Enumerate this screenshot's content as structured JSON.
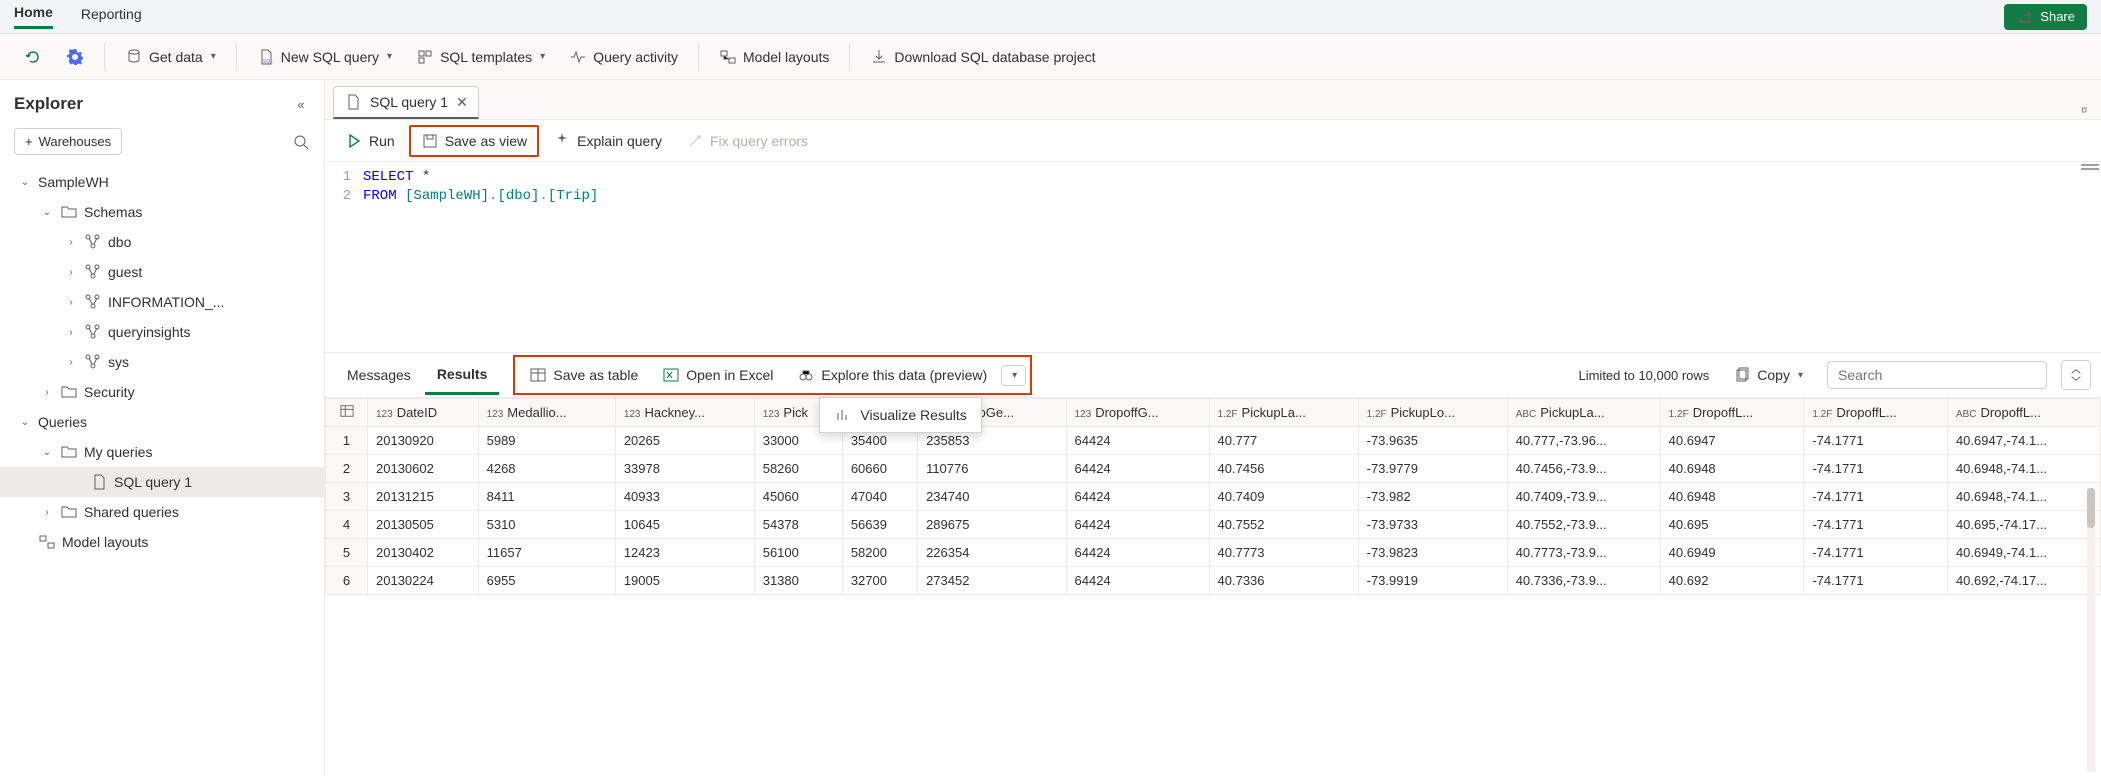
{
  "top": {
    "home": "Home",
    "reporting": "Reporting",
    "share": "Share"
  },
  "toolbar": {
    "get_data": "Get data",
    "new_sql": "New SQL query",
    "sql_templates": "SQL templates",
    "query_activity": "Query activity",
    "model_layouts": "Model layouts",
    "download": "Download SQL database project"
  },
  "explorer": {
    "title": "Explorer",
    "warehouses": "Warehouses",
    "tree": {
      "samplewh": "SampleWH",
      "schemas": "Schemas",
      "dbo": "dbo",
      "guest": "guest",
      "info": "INFORMATION_...",
      "qi": "queryinsights",
      "sys": "sys",
      "security": "Security",
      "queries": "Queries",
      "myq": "My queries",
      "sq1": "SQL query 1",
      "shared": "Shared queries",
      "model": "Model layouts"
    }
  },
  "query_tab": {
    "label": "SQL query 1"
  },
  "qtoolbar": {
    "run": "Run",
    "save_view": "Save as view",
    "explain": "Explain query",
    "fix": "Fix query errors"
  },
  "sql": {
    "l1a": "SELECT",
    "l1b": " *",
    "l2a": "FROM",
    "l2b": " [SampleWH]",
    "l2c": ".",
    "l2d": "[dbo]",
    "l2e": ".",
    "l2f": "[Trip]"
  },
  "results": {
    "messages": "Messages",
    "results": "Results",
    "save_table": "Save as table",
    "open_excel": "Open in Excel",
    "explore": "Explore this data (preview)",
    "visualize": "Visualize Results",
    "limit": "Limited to 10,000 rows",
    "copy": "Copy",
    "search_ph": "Search"
  },
  "columns": [
    {
      "t": "123",
      "n": "DateID"
    },
    {
      "t": "123",
      "n": "Medallio..."
    },
    {
      "t": "123",
      "n": "Hackney..."
    },
    {
      "t": "123",
      "n": "Pick"
    },
    {
      "t": "123",
      "n": ""
    },
    {
      "t": "123",
      "n": "PickupGe..."
    },
    {
      "t": "123",
      "n": "DropoffG..."
    },
    {
      "t": "1.2F",
      "n": "PickupLa..."
    },
    {
      "t": "1.2F",
      "n": "PickupLo..."
    },
    {
      "t": "ABC",
      "n": "PickupLa..."
    },
    {
      "t": "1.2F",
      "n": "DropoffL..."
    },
    {
      "t": "1.2F",
      "n": "DropoffL..."
    },
    {
      "t": "ABC",
      "n": "DropoffL..."
    }
  ],
  "rows": [
    [
      "1",
      "20130920",
      "5989",
      "20265",
      "33000",
      "35400",
      "235853",
      "64424",
      "40.777",
      "-73.9635",
      "40.777,-73.96...",
      "40.6947",
      "-74.1771",
      "40.6947,-74.1..."
    ],
    [
      "2",
      "20130602",
      "4268",
      "33978",
      "58260",
      "60660",
      "110776",
      "64424",
      "40.7456",
      "-73.9779",
      "40.7456,-73.9...",
      "40.6948",
      "-74.1771",
      "40.6948,-74.1..."
    ],
    [
      "3",
      "20131215",
      "8411",
      "40933",
      "45060",
      "47040",
      "234740",
      "64424",
      "40.7409",
      "-73.982",
      "40.7409,-73.9...",
      "40.6948",
      "-74.1771",
      "40.6948,-74.1..."
    ],
    [
      "4",
      "20130505",
      "5310",
      "10645",
      "54378",
      "56639",
      "289675",
      "64424",
      "40.7552",
      "-73.9733",
      "40.7552,-73.9...",
      "40.695",
      "-74.1771",
      "40.695,-74.17..."
    ],
    [
      "5",
      "20130402",
      "11657",
      "12423",
      "56100",
      "58200",
      "226354",
      "64424",
      "40.7773",
      "-73.9823",
      "40.7773,-73.9...",
      "40.6949",
      "-74.1771",
      "40.6949,-74.1..."
    ],
    [
      "6",
      "20130224",
      "6955",
      "19005",
      "31380",
      "32700",
      "273452",
      "64424",
      "40.7336",
      "-73.9919",
      "40.7336,-73.9...",
      "40.692",
      "-74.1771",
      "40.692,-74.17..."
    ]
  ]
}
